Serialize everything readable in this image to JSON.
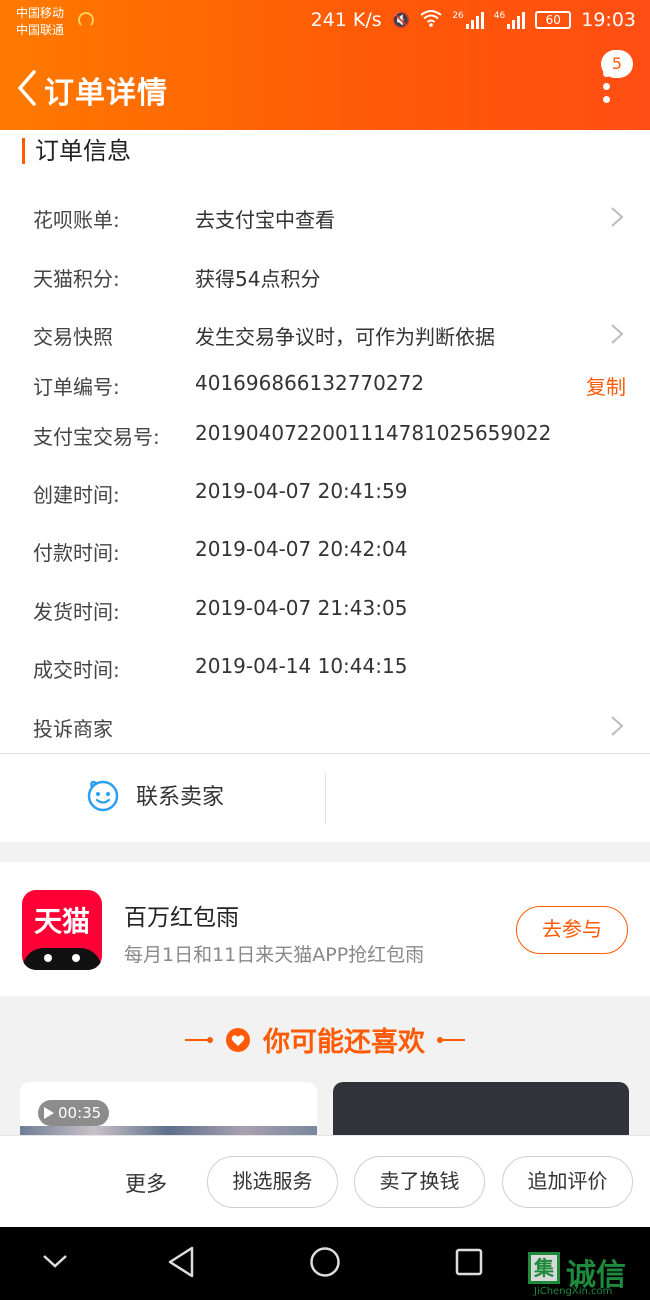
{
  "status_bar": {
    "carrier1": "中国移动",
    "carrier2": "中国联通",
    "speed": "241 K/s",
    "net1": "26",
    "net2": "46",
    "battery": "60",
    "time": "19:03"
  },
  "header": {
    "title": "订单详情",
    "badge_count": "5"
  },
  "order_info": {
    "section_title": "订单信息",
    "rows": [
      {
        "label": "花呗账单:",
        "value": "去支付宝中查看",
        "chevron": true
      },
      {
        "label": "天猫积分:",
        "value": "获得54点积分"
      },
      {
        "label": "交易快照",
        "value": "发生交易争议时，可作为判断依据",
        "chevron": true
      },
      {
        "label": "订单编号:",
        "value": "401696866132770272",
        "action": "复制"
      },
      {
        "label": "支付宝交易号:",
        "value": "2019040722001114781025659022"
      },
      {
        "label": "创建时间:",
        "value": "2019-04-07 20:41:59"
      },
      {
        "label": "付款时间:",
        "value": "2019-04-07 20:42:04"
      },
      {
        "label": "发货时间:",
        "value": "2019-04-07 21:43:05"
      },
      {
        "label": "成交时间:",
        "value": "2019-04-14 10:44:15"
      },
      {
        "label": "投诉商家",
        "value": "",
        "chevron": true
      }
    ]
  },
  "contact": {
    "label": "联系卖家"
  },
  "promo": {
    "logo_text": "天猫",
    "title": "百万红包雨",
    "subtitle": "每月1日和11日来天猫APP抢红包雨",
    "button": "去参与"
  },
  "recommend": {
    "title": "你可能还喜欢",
    "video_duration": "00:35"
  },
  "action_bar": {
    "more": "更多",
    "buttons": [
      "挑选服务",
      "卖了换钱",
      "追加评价"
    ]
  },
  "watermark": {
    "box": "集",
    "text": "诚信",
    "sub": "JiChengXin.com"
  },
  "colors": {
    "accent": "#ff5a06",
    "header_start": "#ff7a00",
    "header_end": "#ff4e13"
  }
}
